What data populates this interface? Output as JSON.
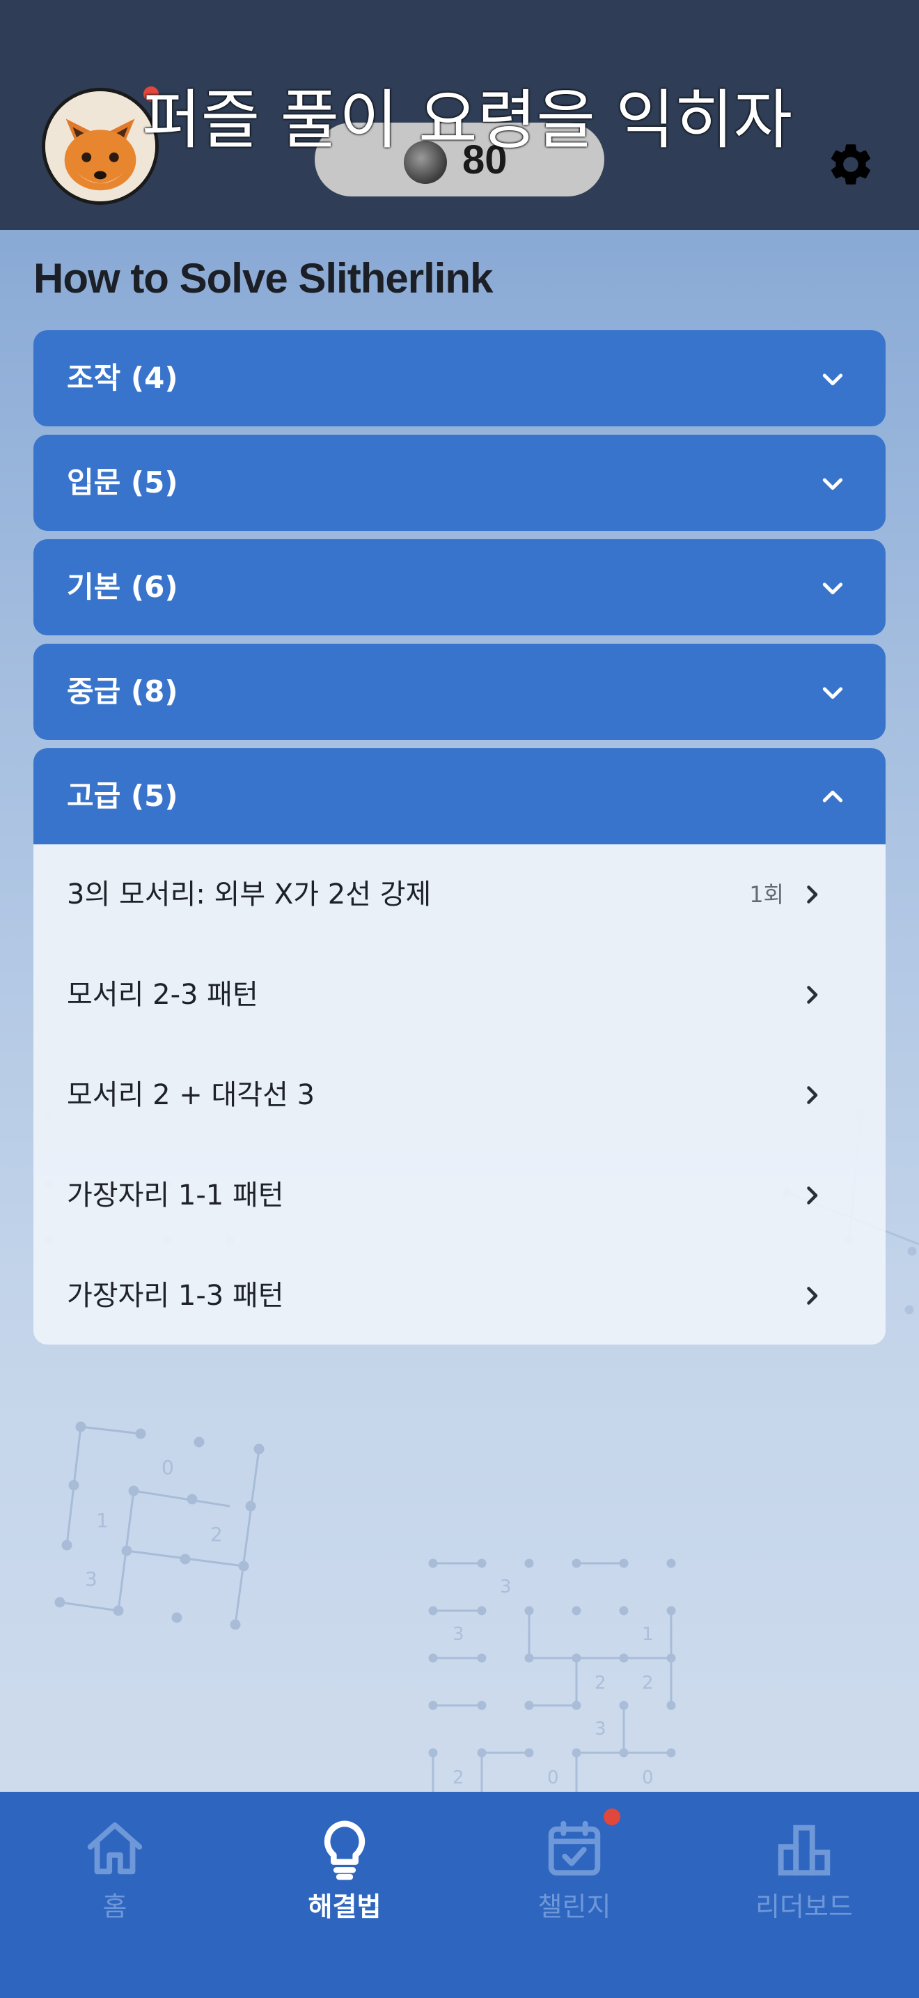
{
  "header": {
    "banner": "퍼즐 풀이 요령을 익히자",
    "coins": "80",
    "avatar_icon": "fox-avatar-icon",
    "settings_icon": "gear-icon"
  },
  "page": {
    "title": "How to Solve Slitherlink"
  },
  "sections": [
    {
      "label": "조작 (4)",
      "expanded": false
    },
    {
      "label": "입문 (5)",
      "expanded": false
    },
    {
      "label": "기본 (6)",
      "expanded": false
    },
    {
      "label": "중급 (8)",
      "expanded": false
    },
    {
      "label": "고급 (5)",
      "expanded": true
    }
  ],
  "advanced_items": [
    {
      "label": "3의 모서리: 외부 X가 2선 강제",
      "count": "1회"
    },
    {
      "label": "모서리 2-3 패턴",
      "count": ""
    },
    {
      "label": "모서리 2 + 대각선 3",
      "count": ""
    },
    {
      "label": "가장자리 1-1 패턴",
      "count": ""
    },
    {
      "label": "가장자리 1-3 패턴",
      "count": ""
    }
  ],
  "nav": {
    "items": [
      {
        "label": "홈",
        "icon": "home-icon",
        "active": false
      },
      {
        "label": "해결법",
        "icon": "lightbulb-icon",
        "active": true
      },
      {
        "label": "챌린지",
        "icon": "calendar-check-icon",
        "active": false,
        "badge": true
      },
      {
        "label": "리더보드",
        "icon": "bar-chart-icon",
        "active": false
      }
    ]
  },
  "colors": {
    "header_bg": "#2f3e56",
    "section_bg": "#3874cb",
    "nav_bg": "#2e65bf",
    "badge": "#e2473b"
  }
}
